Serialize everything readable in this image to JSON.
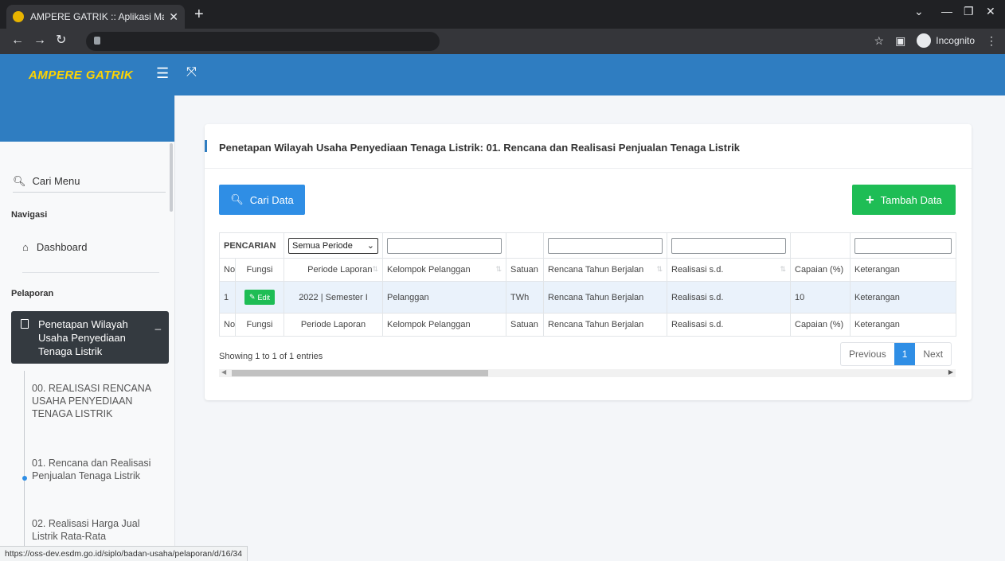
{
  "browser": {
    "tab_title": "AMPERE GATRIK :: Aplikasi Mana",
    "close": "✕",
    "new_tab": "+",
    "incognito_label": "Incognito",
    "status_url": "https://oss-dev.esdm.go.id/siplo/badan-usaha/pelaporan/d/16/34"
  },
  "header": {
    "brand": "AMPERE GATRIK"
  },
  "sidebar": {
    "search_label": "Cari Menu",
    "nav_heading": "Navigasi",
    "dashboard": "Dashboard",
    "report_heading": "Pelaporan",
    "active_item": "Penetapan Wilayah Usaha Penyediaan Tenaga Listrik",
    "sub_items": [
      "00. REALISASI RENCANA USAHA PENYEDIAAN TENAGA LISTRIK",
      "01. Rencana dan Realisasi Penjualan Tenaga Listrik",
      "02. Realisasi Harga Jual Listrik Rata-Rata"
    ]
  },
  "main": {
    "title": "Penetapan Wilayah Usaha Penyediaan Tenaga Listrik: 01. Rencana dan Realisasi Penjualan Tenaga Listrik",
    "search_button": "Cari Data",
    "add_button": "Tambah Data",
    "filter_label": "PENCARIAN",
    "period_select": "Semua Periode",
    "columns": [
      "No",
      "Fungsi",
      "Periode Laporan",
      "Kelompok Pelanggan",
      "Satuan",
      "Rencana Tahun Berjalan",
      "Realisasi s.d.",
      "Capaian (%)",
      "Keterangan"
    ],
    "row": {
      "no": "1",
      "edit": "Edit",
      "periode": "2022 | Semester I",
      "kelompok": "Pelanggan",
      "satuan": "TWh",
      "rencana": "Rencana Tahun Berjalan",
      "realisasi": "Realisasi s.d.",
      "capaian": "10",
      "keterangan": "Keterangan"
    },
    "info": "Showing 1 to 1 of 1 entries",
    "pager": {
      "prev": "Previous",
      "page": "1",
      "next": "Next"
    }
  }
}
